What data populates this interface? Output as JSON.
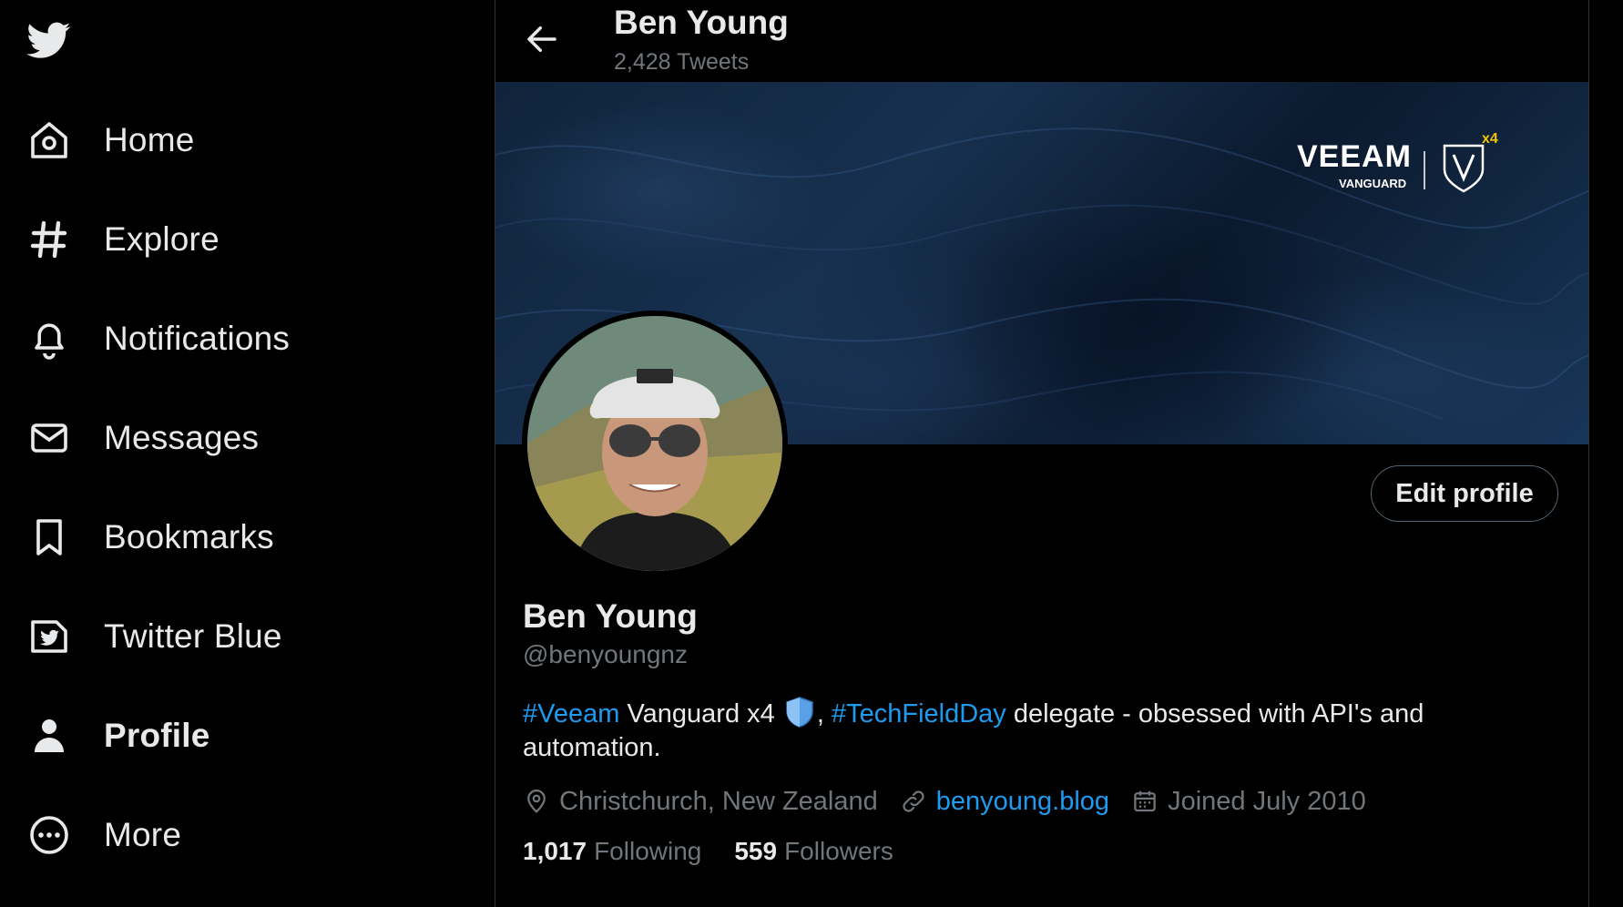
{
  "nav": {
    "items": [
      {
        "label": "Home",
        "icon": "home-icon"
      },
      {
        "label": "Explore",
        "icon": "hashtag-icon"
      },
      {
        "label": "Notifications",
        "icon": "bell-icon"
      },
      {
        "label": "Messages",
        "icon": "envelope-icon"
      },
      {
        "label": "Bookmarks",
        "icon": "bookmark-icon"
      },
      {
        "label": "Twitter Blue",
        "icon": "twitter-blue-icon"
      },
      {
        "label": "Profile",
        "icon": "person-icon",
        "active": true
      },
      {
        "label": "More",
        "icon": "more-circle-icon"
      }
    ]
  },
  "header": {
    "name": "Ben Young",
    "tweet_count": "2,428 Tweets"
  },
  "banner": {
    "brand_name": "VEEAM",
    "brand_sub": "VANGUARD",
    "brand_badge": "x4"
  },
  "profile": {
    "edit_label": "Edit profile",
    "display_name": "Ben Young",
    "handle": "@benyoungnz",
    "bio": {
      "tag1": "#Veeam",
      "text1": " Vanguard x4 ",
      "text2": ", ",
      "tag2": "#TechFieldDay",
      "text3": " delegate - obsessed with API's and automation."
    },
    "location": "Christchurch, New Zealand",
    "website": "benyoung.blog",
    "joined": "Joined July 2010",
    "following_count": "1,017",
    "following_label": "Following",
    "followers_count": "559",
    "followers_label": "Followers"
  },
  "colors": {
    "accent": "#1d9bf0",
    "muted": "#71767b",
    "text": "#e7e9ea",
    "background": "#000000"
  }
}
